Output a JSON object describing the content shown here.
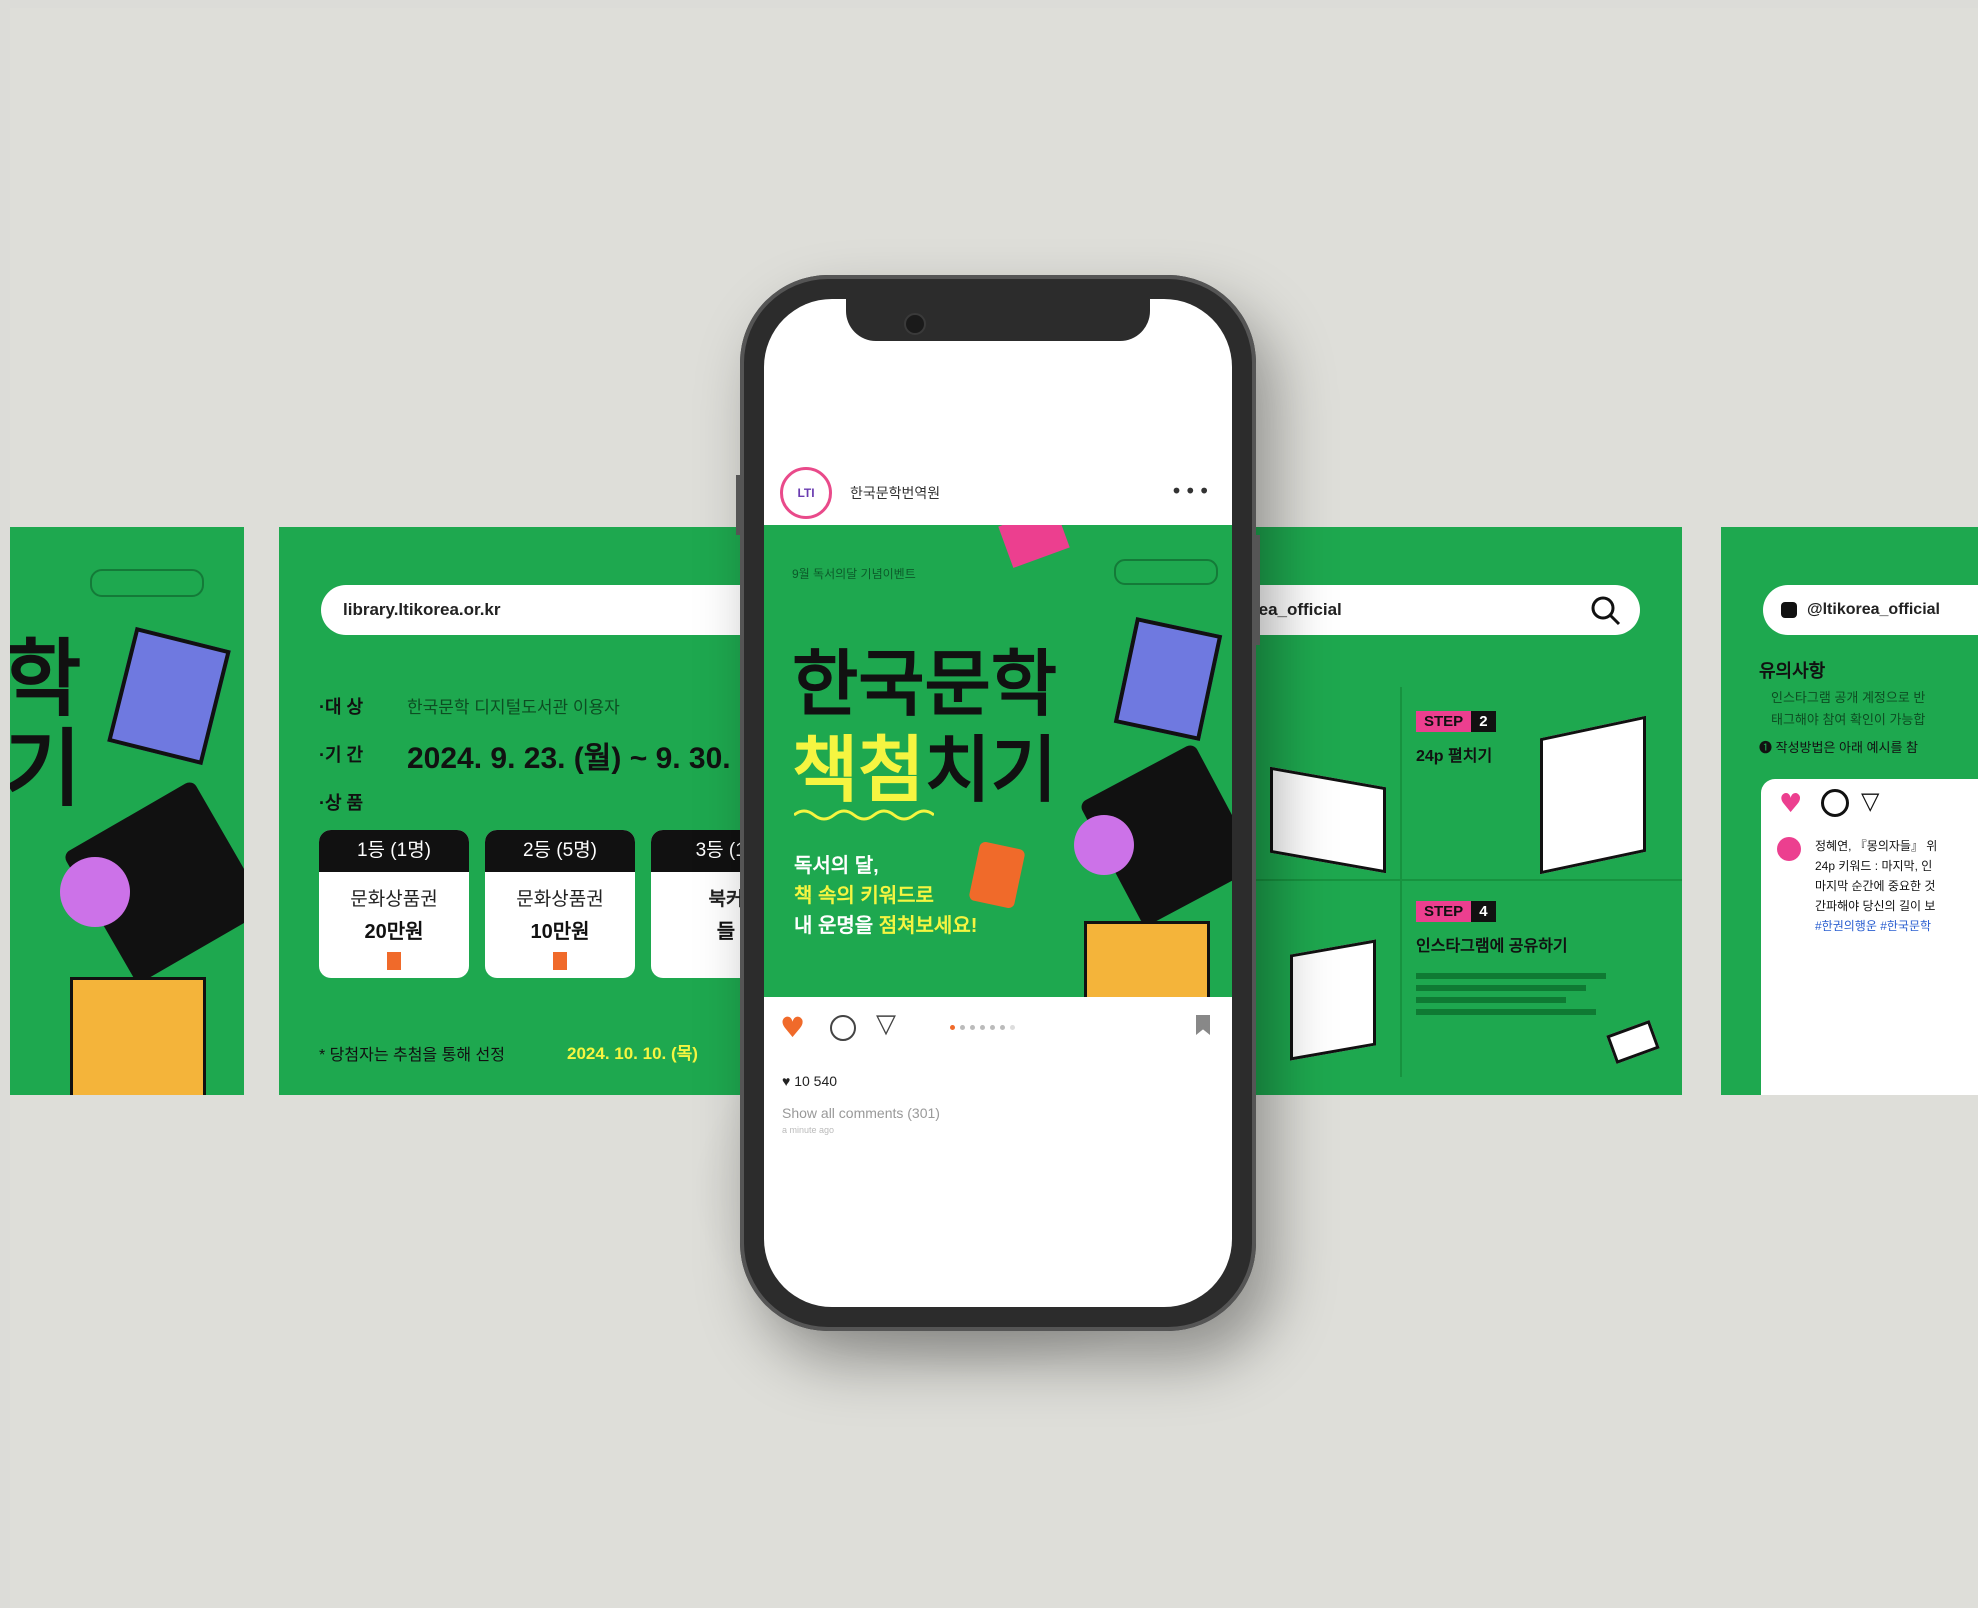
{
  "card2": {
    "url": "library.ltikorea.or.kr",
    "target_label": "·대 상",
    "target_value": "한국문학 디지털도서관 이용자",
    "period_label": "·기 간",
    "period_value": "2024. 9. 23. (월) ~ 9. 30.",
    "prize_label": "·상 품",
    "prizes": [
      {
        "rank": "1등 (1명)",
        "item": "문화상품권",
        "amount": "20만원"
      },
      {
        "rank": "2등 (5명)",
        "item": "문화상품권",
        "amount": "10만원"
      },
      {
        "rank": "3등 (10",
        "item": "북커",
        "amount": "들"
      }
    ],
    "footnote": "* 당첨자는 추첨을 통해 선정",
    "footnote_date": "2024. 10. 10. (목)"
  },
  "card1": {
    "title_top": "학",
    "title_bottom": "기"
  },
  "phone": {
    "account": "한국문학번역원",
    "avatar_text": "LTI",
    "more": "•••",
    "post_tag": "9월 독서의달 기념이벤트",
    "title_line1": "한국문학",
    "title_line2_hl": "책첨",
    "title_line2_rest": "치기",
    "body_line1": "독서의 달,",
    "body_line2": "책 속의 키워드로",
    "body_line3_a": "내 운명을 ",
    "body_line3_b": "점쳐보세요!",
    "likes": "10 540",
    "comments": "Show all comments (301)",
    "ago": "a minute ago"
  },
  "card3": {
    "search": "rea_official",
    "step2_badge": "STEP",
    "step2_num": "2",
    "step2_label": "24p 펼치기",
    "step4_badge": "STEP",
    "step4_num": "4",
    "step4_label": "인스타그램에 공유하기"
  },
  "card4": {
    "handle": "@ltikorea_official",
    "notice_title": "유의사항",
    "notice1": "인스타그램 공개 계정으로 반",
    "notice2": "태그해야 참여 확인이 가능합",
    "notice3": "작성방법은 아래 예시를 참",
    "comment1": "정혜연, 『몽의자들』 위",
    "comment2": "24p 키워드 : 마지막, 인",
    "comment3": "마지막 순간에 중요한 것",
    "comment4": "간파해야 당신의 길이 보",
    "hashtags": "#한권의행운 #한국문학"
  },
  "colors": {
    "background": "#deded9",
    "green": "#1ea84f",
    "yellow": "#f5f541",
    "pink": "#ec3f8f",
    "heart": "#f06a2a"
  }
}
